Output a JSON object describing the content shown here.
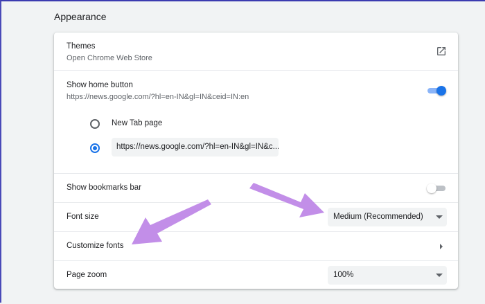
{
  "section": {
    "title": "Appearance"
  },
  "themes": {
    "label": "Themes",
    "sublabel": "Open Chrome Web Store",
    "icon": "open-in-new-icon"
  },
  "home_button": {
    "label": "Show home button",
    "sublabel": "https://news.google.com/?hl=en-IN&gl=IN&ceid=IN:en",
    "enabled": true,
    "options": [
      {
        "label": "New Tab page",
        "selected": false
      },
      {
        "value": "https://news.google.com/?hl=en-IN&gl=IN&c...",
        "selected": true
      }
    ]
  },
  "bookmarks_bar": {
    "label": "Show bookmarks bar",
    "enabled": false
  },
  "font_size": {
    "label": "Font size",
    "value": "Medium (Recommended)"
  },
  "customize_fonts": {
    "label": "Customize fonts"
  },
  "page_zoom": {
    "label": "Page zoom",
    "value": "100%"
  },
  "colors": {
    "accent": "#1a73e8",
    "annotation_arrow": "#c28ee8"
  }
}
